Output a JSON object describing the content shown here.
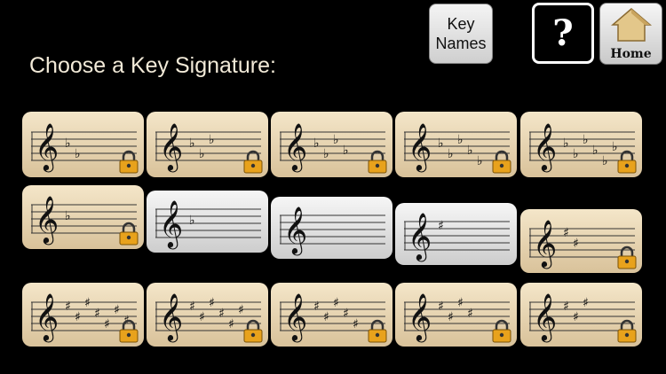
{
  "title": "Choose a Key Signature:",
  "key_names_button": {
    "line1": "Key",
    "line2": "Names"
  },
  "help_button": {
    "label": "?"
  },
  "home_button": {
    "label": "Home"
  },
  "colors": {
    "locked_card": "#e9d6b0",
    "unlocked_card": "#e2e2e2",
    "background": "#000000"
  },
  "key_signatures": [
    {
      "accidental": "flat",
      "count": 2,
      "locked": true,
      "row": 1
    },
    {
      "accidental": "flat",
      "count": 3,
      "locked": true,
      "row": 1
    },
    {
      "accidental": "flat",
      "count": 4,
      "locked": true,
      "row": 1
    },
    {
      "accidental": "flat",
      "count": 5,
      "locked": true,
      "row": 1
    },
    {
      "accidental": "flat",
      "count": 6,
      "locked": true,
      "row": 1
    },
    {
      "accidental": "flat",
      "count": 1,
      "locked": true,
      "row": 2
    },
    {
      "accidental": "flat",
      "count": 1,
      "locked": false,
      "row": 2
    },
    {
      "accidental": "none",
      "count": 0,
      "locked": false,
      "row": 2
    },
    {
      "accidental": "sharp",
      "count": 1,
      "locked": false,
      "row": 2
    },
    {
      "accidental": "sharp",
      "count": 2,
      "locked": true,
      "row": 2
    },
    {
      "accidental": "sharp",
      "count": 7,
      "locked": true,
      "row": 3
    },
    {
      "accidental": "sharp",
      "count": 6,
      "locked": true,
      "row": 3
    },
    {
      "accidental": "sharp",
      "count": 5,
      "locked": true,
      "row": 3
    },
    {
      "accidental": "sharp",
      "count": 4,
      "locked": true,
      "row": 3
    },
    {
      "accidental": "sharp",
      "count": 3,
      "locked": true,
      "row": 3
    }
  ]
}
